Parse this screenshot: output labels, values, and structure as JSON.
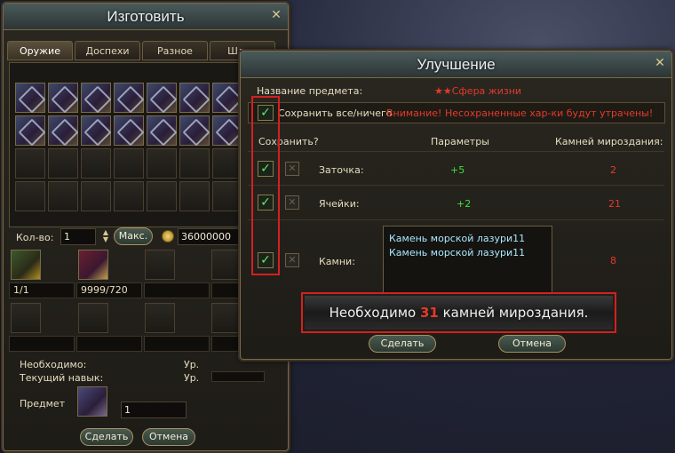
{
  "craft": {
    "title": "Изготовить",
    "tabs": [
      "Оружие",
      "Доспехи",
      "Разное",
      "Шлем"
    ],
    "qty_label": "Кол-во:",
    "qty_value": "1",
    "max_label": "Макс.",
    "money": "36000000",
    "material_1_count": "1/1",
    "material_2_count": "9999/720",
    "required_label": "Необходимо:",
    "current_skill_label": "Текущий навык:",
    "level_label_1": "Ур.",
    "level_label_2": "Ур.",
    "item_label": "Предмет",
    "item_qty": "1",
    "make_button": "Сделать",
    "cancel_button": "Отмена"
  },
  "upgrade": {
    "title": "Улучшение",
    "item_name_label": "Название предмета:",
    "item_name": "★★Сфера жизни",
    "save_all_label": "Сохранить все/ничего",
    "warning": "Внимание! Несохраненные хар-ки будут утрачены!",
    "col_save": "Сохранить?",
    "col_params": "Параметры",
    "col_stones": "Камней мироздания:",
    "rows": [
      {
        "name": "Заточка:",
        "param": "+5",
        "stones": "2"
      },
      {
        "name": "Ячейки:",
        "param": "+2",
        "stones": "21"
      },
      {
        "name": "Камни:",
        "param": "",
        "stones": "8"
      }
    ],
    "stone_items": [
      "Камень морской лазури11",
      "Камень морской лазури11"
    ],
    "required_prefix": "Необходимо",
    "required_count": "31",
    "required_suffix": "камней мироздания.",
    "make_button": "Сделать",
    "cancel_button": "Отмена"
  },
  "colors": {
    "green_value": "#3ee03e",
    "red_value": "#e43a2a",
    "highlight": "#d42020"
  }
}
